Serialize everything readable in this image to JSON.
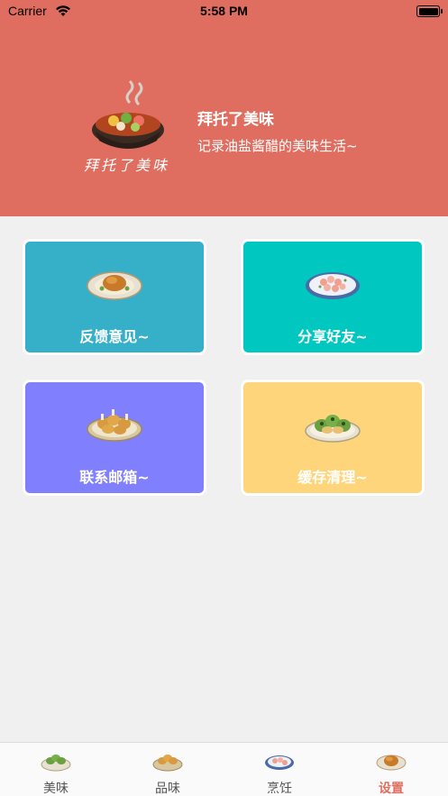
{
  "status_bar": {
    "carrier": "Carrier",
    "time": "5:58 PM"
  },
  "header": {
    "logo_text": "拜托了美味",
    "title": "拜托了美味",
    "subtitle": "记录油盐酱醋的美味生活~"
  },
  "cards": [
    {
      "label": "反馈意见~",
      "color": "#35b0c8",
      "icon": "roast-chicken-plate-icon"
    },
    {
      "label": "分享好友~",
      "color": "#00c8c0",
      "icon": "shrimp-plate-icon"
    },
    {
      "label": "联系邮箱~",
      "color": "#8080fe",
      "icon": "fried-drumsticks-plate-icon"
    },
    {
      "label": "缓存清理~",
      "color": "#fed57a",
      "icon": "green-dumplings-plate-icon"
    }
  ],
  "tabbar": {
    "items": [
      {
        "label": "美味",
        "icon": "green-dumplings-tab-icon"
      },
      {
        "label": "品味",
        "icon": "fried-drumsticks-tab-icon"
      },
      {
        "label": "烹饪",
        "icon": "shrimp-tab-icon"
      },
      {
        "label": "设置",
        "icon": "roast-chicken-tab-icon"
      }
    ],
    "active_index": 3,
    "active_color": "#e06e60"
  }
}
